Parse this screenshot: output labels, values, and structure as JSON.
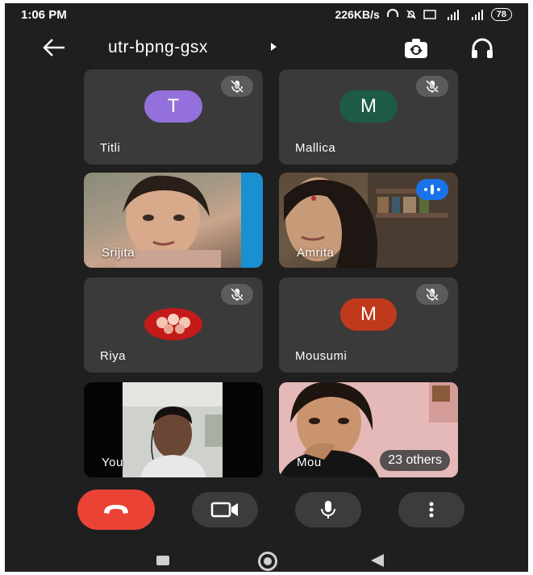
{
  "status": {
    "time": "1:06 PM",
    "net_speed": "226KB/s",
    "battery": "78"
  },
  "header": {
    "meeting_code": "utr-bpng-gsx"
  },
  "tiles": [
    {
      "name": "Titli",
      "initial": "T",
      "avatar_color": "#9370db",
      "muted": true
    },
    {
      "name": "Mallica",
      "initial": "M",
      "avatar_color": "#1e5b45",
      "muted": true
    },
    {
      "name": "Srijita"
    },
    {
      "name": "Amrita",
      "speaking": true
    },
    {
      "name": "Riya",
      "muted": true
    },
    {
      "name": "Mousumi",
      "initial": "M",
      "avatar_color": "#c0391b",
      "muted": true
    },
    {
      "name": "You"
    },
    {
      "name": "Mou",
      "others": "23 others"
    }
  ],
  "colors": {
    "end_call": "#ea4335",
    "speaking": "#1a73e8",
    "tile_bg": "#3a3a3a",
    "background": "#1f1f1f"
  }
}
